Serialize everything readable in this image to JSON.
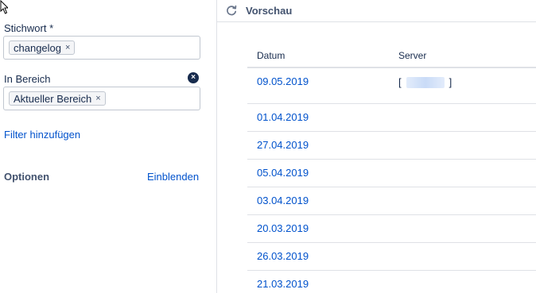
{
  "filters": {
    "keyword": {
      "label": "Stichwort *",
      "tag": "changelog"
    },
    "scope": {
      "label": "In Bereich",
      "tag": "Aktueller Bereich"
    },
    "tag_remove_glyph": "×",
    "clear_glyph": "×",
    "add_filter_label": "Filter hinzufügen"
  },
  "options": {
    "label": "Optionen",
    "toggle_label": "Einblenden"
  },
  "preview": {
    "title": "Vorschau",
    "columns": {
      "date": "Datum",
      "server": "Server"
    },
    "rows": [
      {
        "date": "09.05.2019",
        "server_open": "[",
        "server_close": "]"
      },
      {
        "date": "01.04.2019"
      },
      {
        "date": "27.04.2019"
      },
      {
        "date": "05.04.2019"
      },
      {
        "date": "03.04.2019"
      },
      {
        "date": "20.03.2019"
      },
      {
        "date": "26.03.2019"
      },
      {
        "date": "21.03.2019"
      }
    ]
  },
  "colors": {
    "link": "#0052cc",
    "text": "#172b4d",
    "border": "#dfe1e6"
  },
  "icons": {
    "cursor": "mouse-pointer-icon",
    "clear": "clear-circle-icon",
    "refresh": "refresh-icon"
  }
}
